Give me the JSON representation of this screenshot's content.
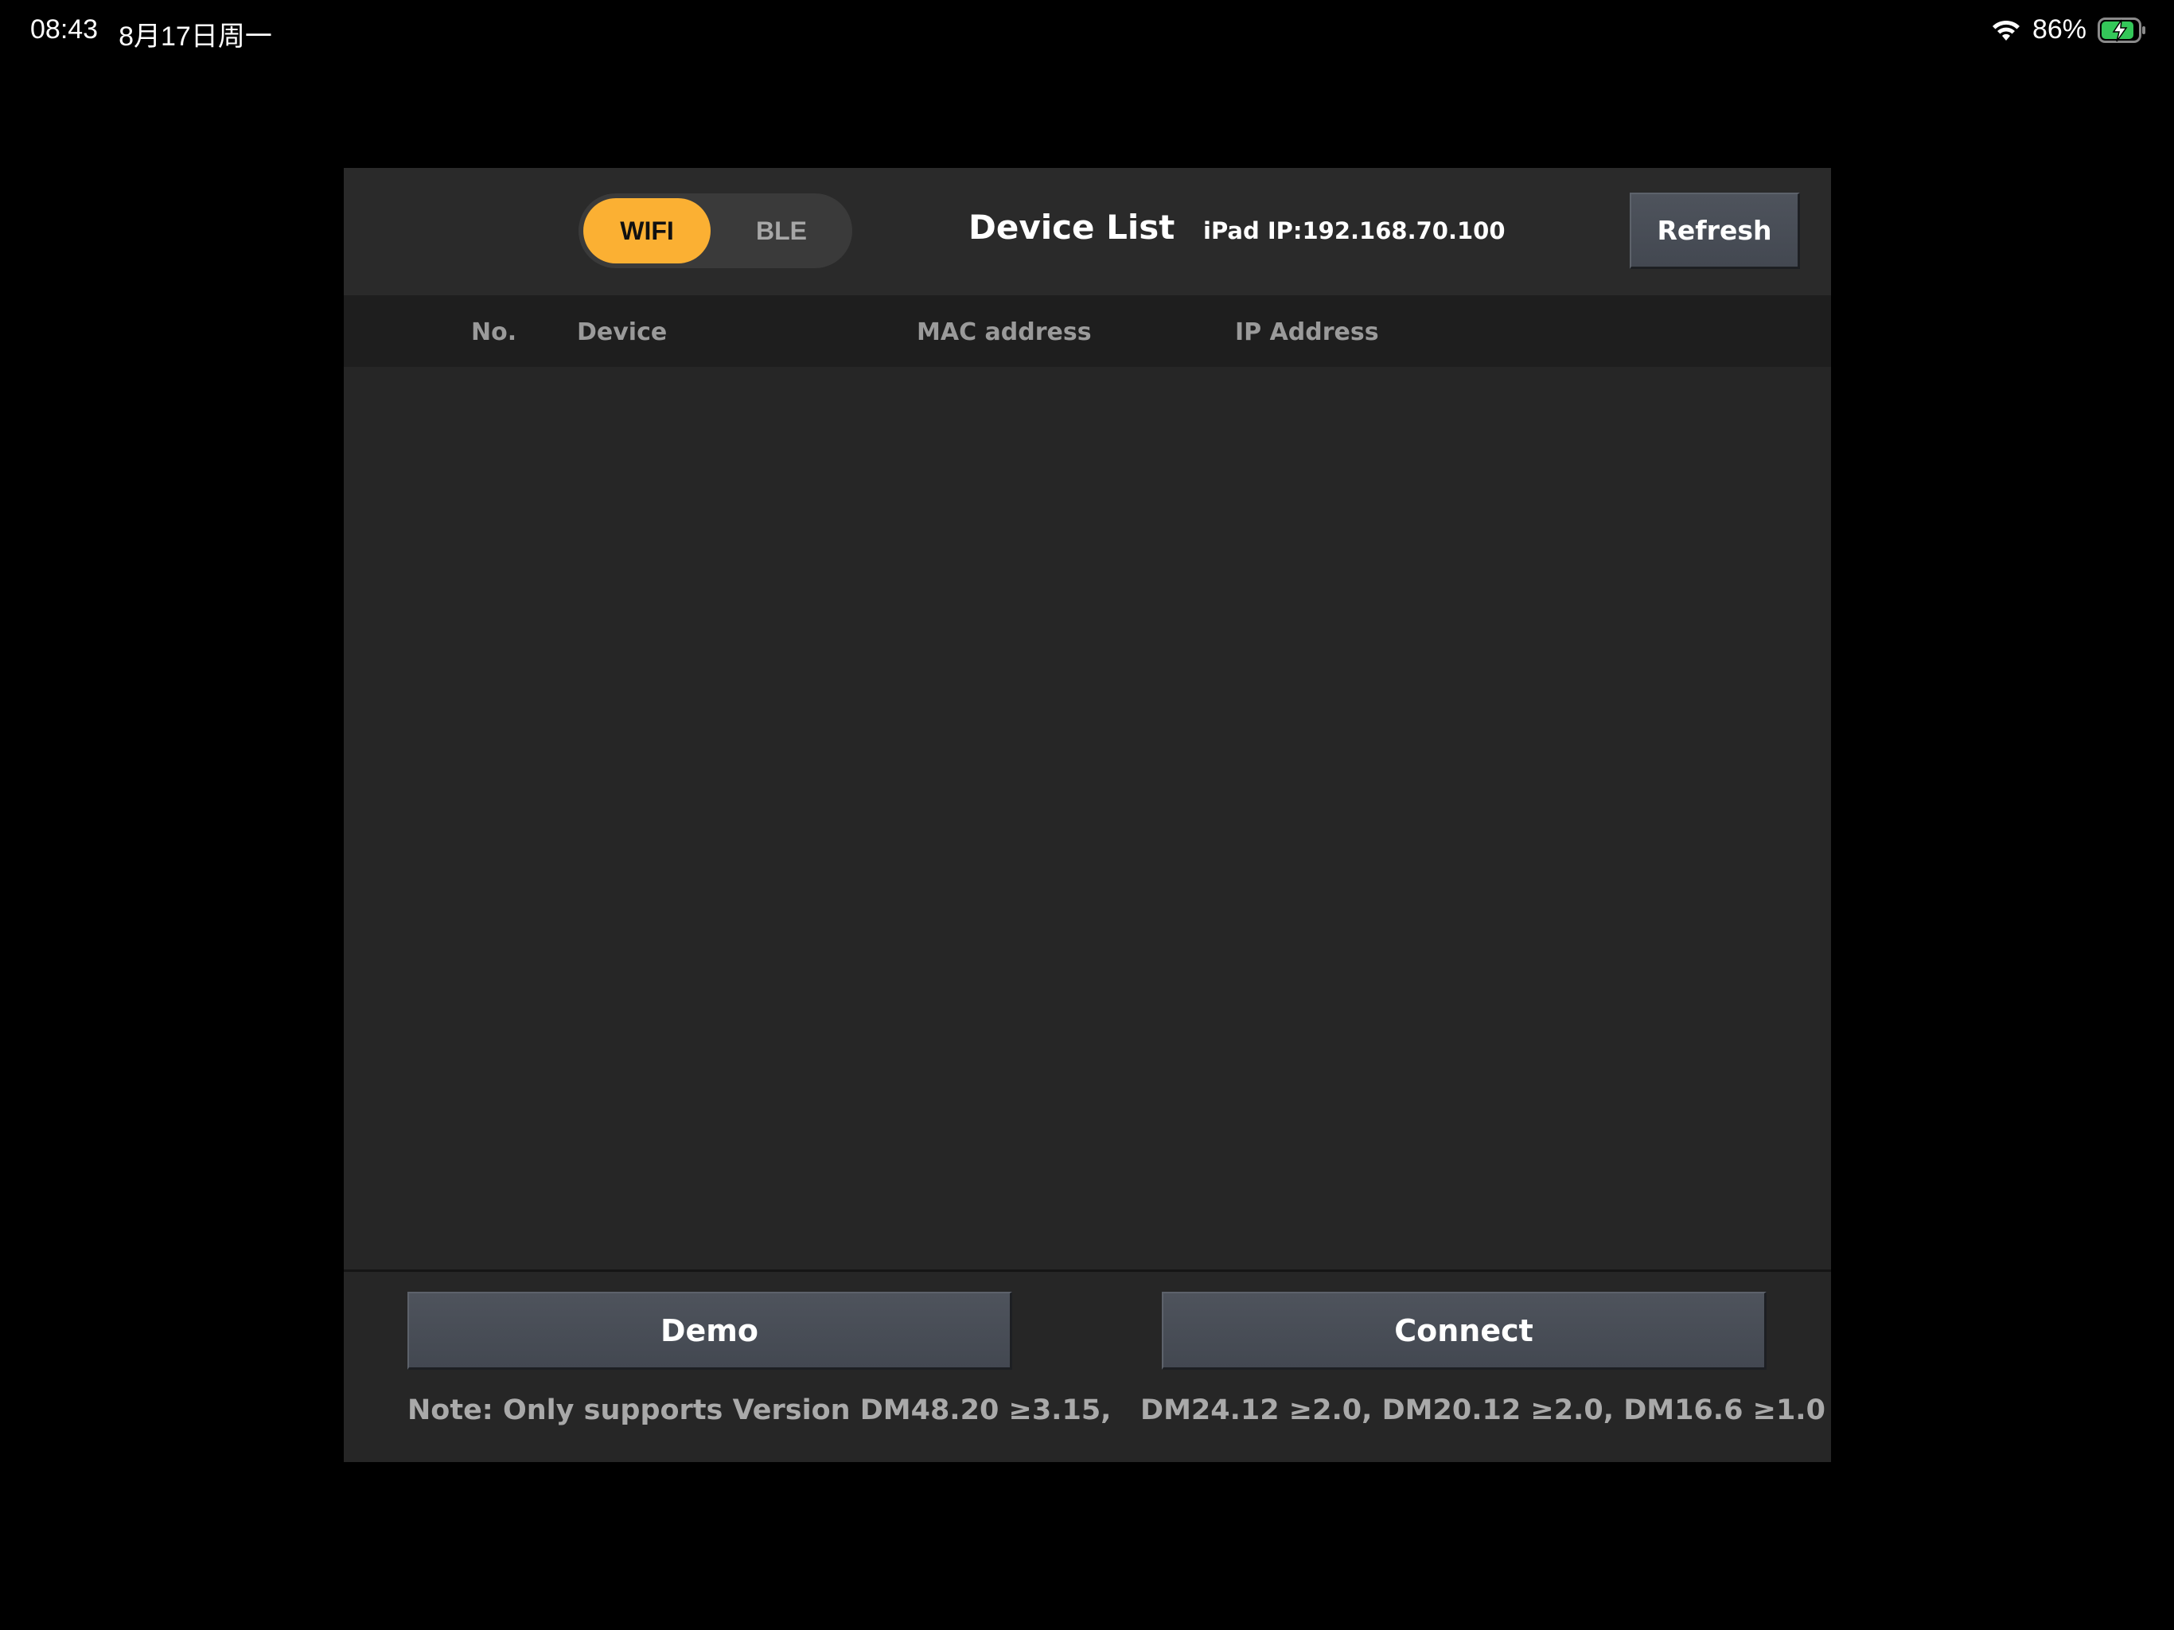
{
  "status_bar": {
    "time": "08:43",
    "date": "8月17日周一",
    "battery_percent": "86%"
  },
  "header": {
    "segment_wifi": "WIFI",
    "segment_ble": "BLE",
    "selected_segment": "WIFI",
    "title": "Device List",
    "ipad_ip": "iPad IP:192.168.70.100",
    "refresh_label": "Refresh"
  },
  "table": {
    "columns": [
      "No.",
      "Device",
      "MAC address",
      "IP Address"
    ],
    "rows": []
  },
  "footer": {
    "demo_label": "Demo",
    "connect_label": "Connect",
    "note": "Note: Only supports Version DM48.20 ≥3.15,   DM24.12 ≥2.0, DM20.12 ≥2.0, DM16.6 ≥1.0"
  },
  "colors": {
    "accent": "#fbb033",
    "panel": "#262626",
    "button": "#484d56",
    "battery": "#34c759"
  },
  "icons": {
    "wifi": "wifi-icon",
    "battery": "battery-charging-icon"
  }
}
